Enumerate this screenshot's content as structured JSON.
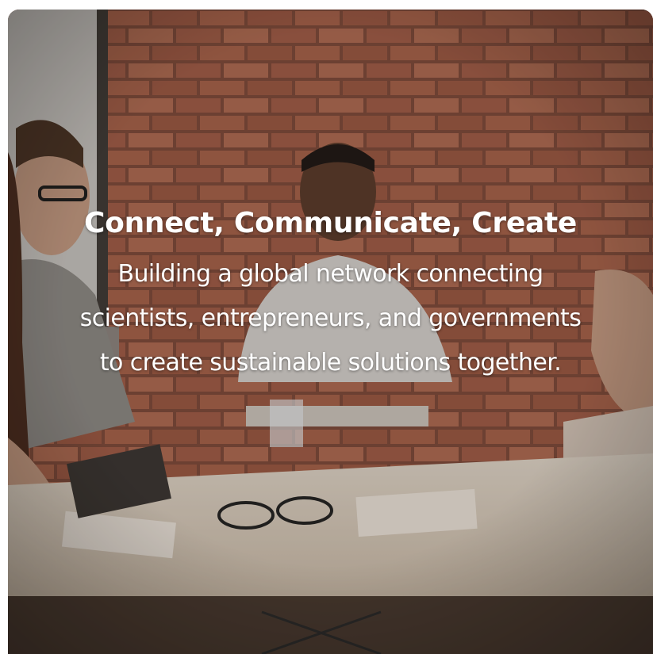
{
  "hero": {
    "headline": "Connect, Communicate, Create",
    "subtext": "Building a global network connecting scientists, entrepreneurs, and governments to create sustainable solutions together."
  },
  "colors": {
    "text": "#ffffff",
    "brick": "#9a5a44",
    "table": "#d9cdbf"
  }
}
